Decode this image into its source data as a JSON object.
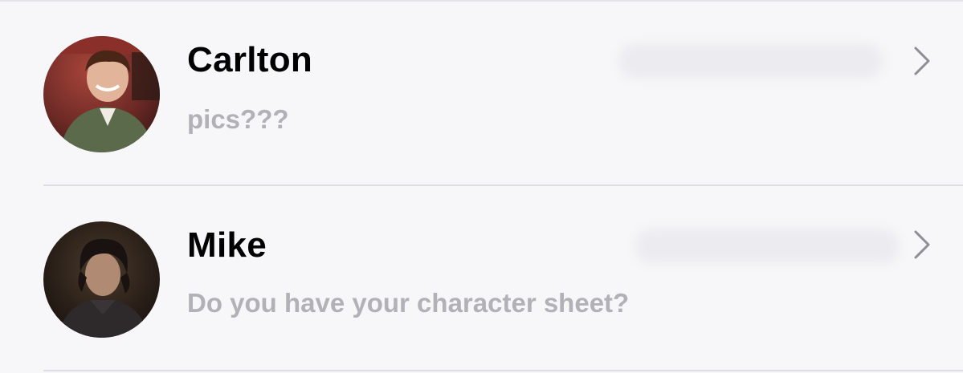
{
  "conversations": [
    {
      "name": "Carlton",
      "preview": "pics???",
      "avatar": "carlton-avatar"
    },
    {
      "name": "Mike",
      "preview": "Do you have your character sheet?",
      "avatar": "mike-avatar"
    }
  ],
  "icons": {
    "disclosure": "chevron-right-icon"
  },
  "colors": {
    "background": "#f7f7f9",
    "name_text": "#000000",
    "preview_text": "#b1b1b6",
    "divider": "#dedee2",
    "chevron": "#8e8e93"
  }
}
